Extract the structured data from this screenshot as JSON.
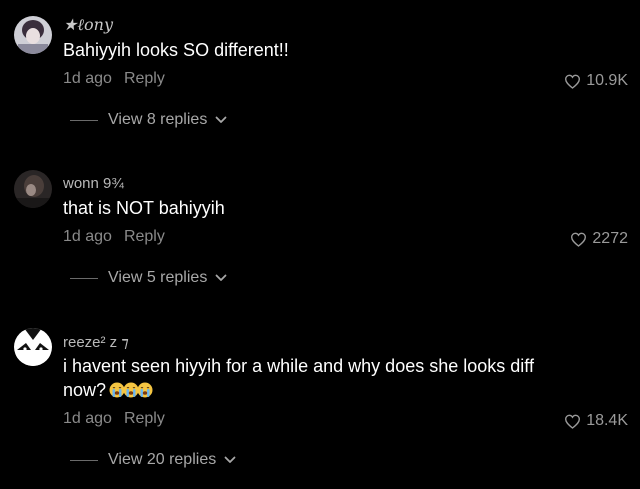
{
  "comments": [
    {
      "username": "★ℓony",
      "text": "Bahiyyih looks SO different!!",
      "time": "1d ago",
      "reply_label": "Reply",
      "likes": "10.9K",
      "view_replies": "View 8 replies"
    },
    {
      "username": "wonn 9¾",
      "text": "that is NOT bahiyyih",
      "time": "1d ago",
      "reply_label": "Reply",
      "likes": "2272",
      "view_replies": "View 5 replies"
    },
    {
      "username": "reeze² z ⁊",
      "text": "i havent seen hiyyih for a while and why does she looks diff now?",
      "emojis": [
        "loudly-crying-face-emoji",
        "loudly-crying-face-emoji",
        "loudly-crying-face-emoji"
      ],
      "time": "1d ago",
      "reply_label": "Reply",
      "likes": "18.4K",
      "view_replies": "View 20 replies"
    }
  ],
  "colors": {
    "background": "#000000",
    "text": "#ffffff",
    "muted": "#8a8a8a",
    "emoji": "#f4c542"
  },
  "icons": {
    "like": "heart-outline-icon",
    "expand": "chevron-down-icon"
  }
}
